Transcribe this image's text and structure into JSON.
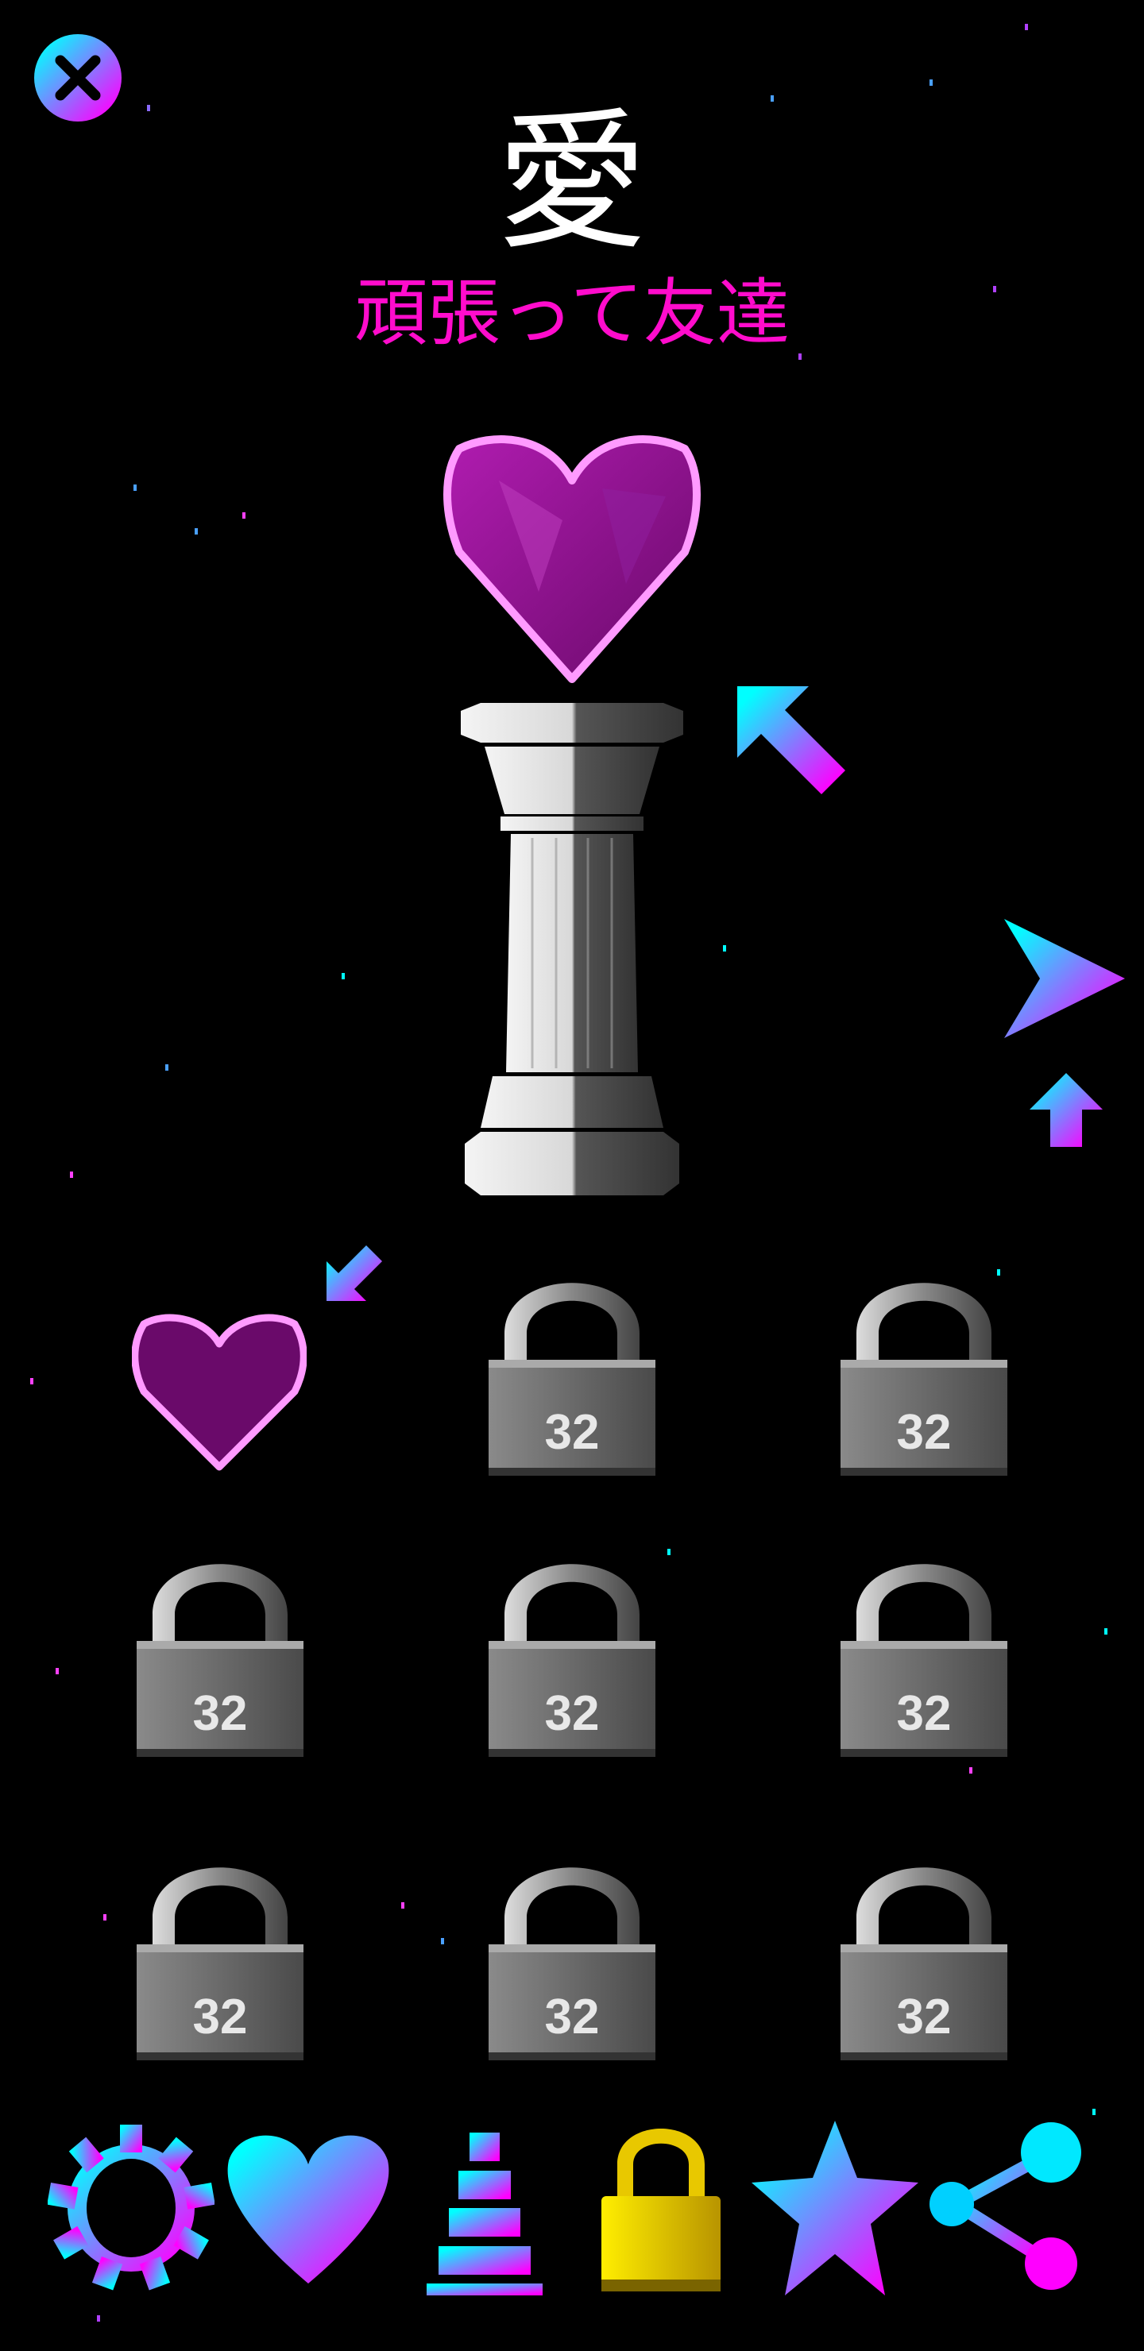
{
  "header": {
    "title": "愛",
    "subtitle": "頑張って友達"
  },
  "grid": {
    "unlocked_item": "heart",
    "locks": [
      {
        "label": "32"
      },
      {
        "label": "32"
      },
      {
        "label": "32"
      },
      {
        "label": "32"
      },
      {
        "label": "32"
      },
      {
        "label": "32"
      },
      {
        "label": "32"
      },
      {
        "label": "32"
      }
    ]
  },
  "bottom_nav": [
    "settings-icon",
    "heart-icon",
    "leaderboard-icon",
    "lock-icon",
    "star-icon",
    "share-icon"
  ],
  "colors": {
    "cyan": "#00ffff",
    "magenta": "#ff00ff",
    "subtitle": "#ff0ccc",
    "gold": "#f5d000"
  }
}
